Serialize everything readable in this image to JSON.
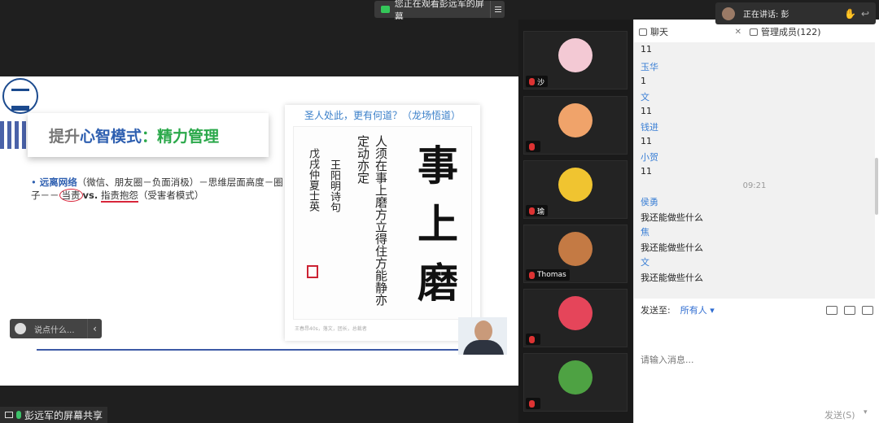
{
  "top_banner": {
    "text": "您正在观看彭远军的屏幕"
  },
  "speaking": {
    "label": "正在讲话: 彭"
  },
  "slide": {
    "title_part1": "提升",
    "title_part2": "心智模式",
    "title_part3": "：精力管理",
    "bullet_highlight": "远离网络",
    "bullet_part1": "（微信、朋友圈－负面消极）－思维层面高度－圈子－－",
    "bullet_circled": "当责",
    "bullet_part2": "vs.",
    "bullet_underlined": "指责抱怨",
    "bullet_part3": "（受害者模式）",
    "callig_caption": "圣人处此，更有何道？（龙场悟道）",
    "callig_big": [
      "事",
      "上",
      "磨"
    ],
    "callig_small_cols": [
      "人须在事上磨方立得住方能静亦定动亦定",
      "王阳明诗句",
      "戊戌仲夏士英"
    ],
    "callig_footer": "王春昂40s，落文，团长，总裁者"
  },
  "comment_bar": {
    "placeholder": "说点什么..."
  },
  "bottom_label": {
    "text": "彭远军的屏幕共享"
  },
  "participants": [
    {
      "name": "沙",
      "avatar_color": "#f3c9d4"
    },
    {
      "name": "",
      "avatar_color": "#f0a36a"
    },
    {
      "name": "瑜",
      "avatar_color": "#f0c430"
    },
    {
      "name": "Thomas",
      "avatar_color": "#c47a44"
    },
    {
      "name": "",
      "avatar_color": "#e5455a"
    },
    {
      "name": "",
      "avatar_color": "#4ea243"
    }
  ],
  "chat": {
    "tab_chat": "聊天",
    "tab_members": "管理成员(122)",
    "messages": [
      {
        "kind": "text",
        "value": "11"
      },
      {
        "kind": "name",
        "value": "玉华"
      },
      {
        "kind": "text",
        "value": "1"
      },
      {
        "kind": "name",
        "value": "文"
      },
      {
        "kind": "text",
        "value": "11"
      },
      {
        "kind": "name",
        "value": "钱进"
      },
      {
        "kind": "text",
        "value": "11"
      },
      {
        "kind": "name",
        "value": "小贺"
      },
      {
        "kind": "text",
        "value": "11"
      },
      {
        "kind": "time",
        "value": "09:21"
      },
      {
        "kind": "name",
        "value": "侯勇"
      },
      {
        "kind": "text",
        "value": "我还能做些什么"
      },
      {
        "kind": "name",
        "value": "焦"
      },
      {
        "kind": "text",
        "value": "我还能做些什么"
      },
      {
        "kind": "name",
        "value": "文"
      },
      {
        "kind": "text",
        "value": "我还能做些什么"
      }
    ],
    "send_to_label": "发送至:",
    "send_to_value": "所有人 ▾",
    "input_placeholder": "请输入消息...",
    "send_button": "发送(S)"
  }
}
